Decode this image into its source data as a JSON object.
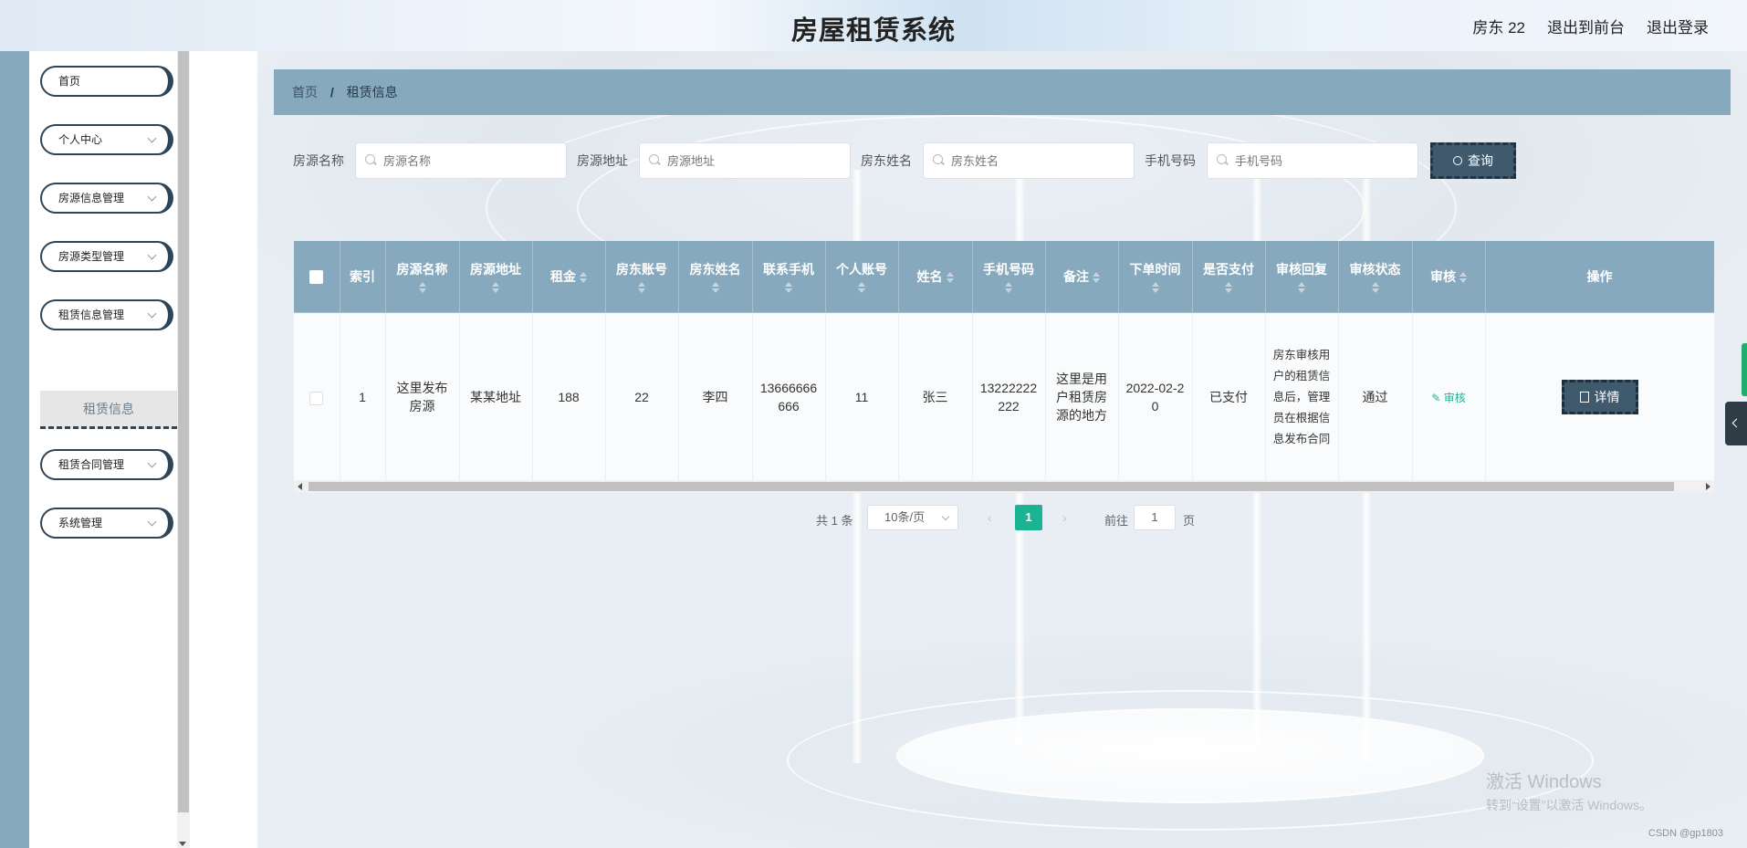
{
  "header": {
    "title": "房屋租赁系统",
    "user_label": "房东 22",
    "front_link": "退出到前台",
    "logout_link": "退出登录"
  },
  "sidebar": {
    "items": [
      {
        "label": "首页",
        "has_arrow": false
      },
      {
        "label": "个人中心",
        "has_arrow": true
      },
      {
        "label": "房源信息管理",
        "has_arrow": true
      },
      {
        "label": "房源类型管理",
        "has_arrow": true
      },
      {
        "label": "租赁信息管理",
        "has_arrow": true
      },
      {
        "label": "租赁合同管理",
        "has_arrow": true
      },
      {
        "label": "系统管理",
        "has_arrow": true
      }
    ],
    "active_sub": "租赁信息"
  },
  "breadcrumb": {
    "home": "首页",
    "separator": "/",
    "current": "租赁信息"
  },
  "search": {
    "fields": [
      {
        "label": "房源名称",
        "placeholder": "房源名称"
      },
      {
        "label": "房源地址",
        "placeholder": "房源地址"
      },
      {
        "label": "房东姓名",
        "placeholder": "房东姓名"
      },
      {
        "label": "手机号码",
        "placeholder": "手机号码"
      }
    ],
    "button": "查询"
  },
  "table": {
    "headers": [
      "索引",
      "房源名称",
      "房源地址",
      "租金",
      "房东账号",
      "房东姓名",
      "联系手机",
      "个人账号",
      "姓名",
      "手机号码",
      "备注",
      "下单时间",
      "是否支付",
      "审核回复",
      "审核状态",
      "审核",
      "操作"
    ],
    "rows": [
      {
        "index": "1",
        "house_name": "这里发布房源",
        "house_addr": "某某地址",
        "rent": "188",
        "landlord_account": "22",
        "landlord_name": "李四",
        "contact_phone": "13666666666",
        "user_account": "11",
        "name": "张三",
        "phone": "13222222222",
        "remark": "这里是用户租赁房源的地方",
        "order_time": "2022-02-20",
        "paid": "已支付",
        "audit_reply": "房东审核用户的租赁信息后，管理员在根据信息发布合同",
        "audit_status": "通过",
        "audit_action": "审核",
        "detail_button": "详情"
      }
    ]
  },
  "pagination": {
    "total": "共 1 条",
    "page_size": "10条/页",
    "current_page": "1",
    "goto_label": "前往",
    "goto_value": "1",
    "page_word": "页"
  },
  "watermark": {
    "line1": "激活 Windows",
    "line2": "转到“设置”以激活 Windows。"
  },
  "credit": "CSDN @gp1803",
  "colors": {
    "accent": "#87a9bd",
    "dark_button": "#3f5a6d",
    "active_page": "#1bb394"
  }
}
